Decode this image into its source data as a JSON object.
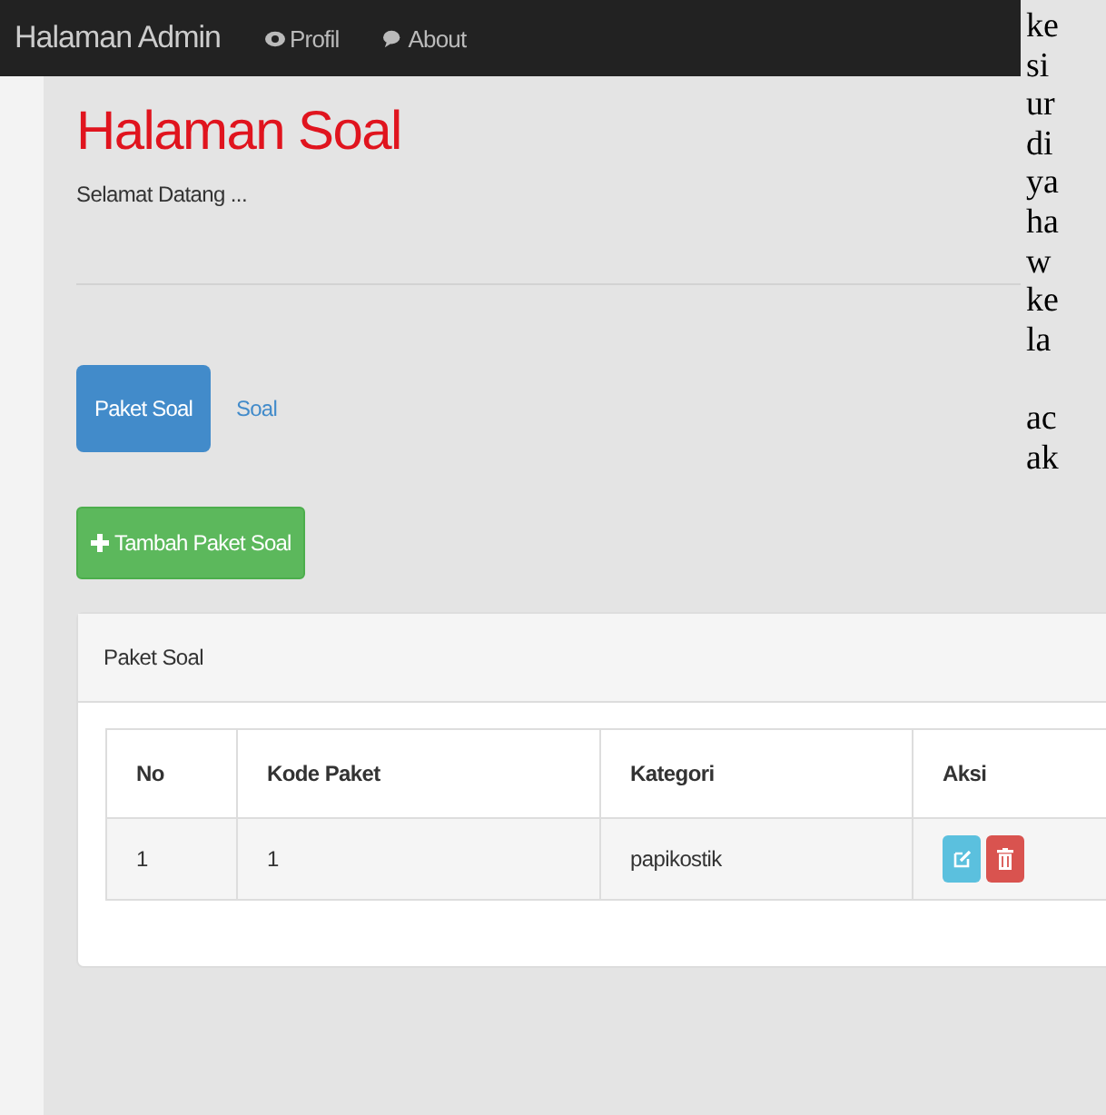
{
  "navbar": {
    "brand": "Halaman Admin",
    "links": [
      {
        "label": "Profil"
      },
      {
        "label": "About"
      }
    ]
  },
  "header": {
    "title": "Halaman Soal",
    "subtitle": "Selamat Datang ..."
  },
  "tabs": [
    {
      "label": "Paket Soal",
      "selected": true
    },
    {
      "label": "Soal",
      "selected": false
    }
  ],
  "add_button": {
    "label": "Tambah Paket Soal"
  },
  "panel": {
    "heading": "Paket Soal",
    "table": {
      "columns": [
        "No",
        "Kode Paket",
        "Kategori",
        "Aksi"
      ],
      "rows": [
        {
          "cells": [
            "1",
            "1",
            "papikostik"
          ]
        }
      ]
    }
  },
  "overlay_text": [
    {
      "lines": [
        "ke",
        "si",
        "ur",
        "di",
        "ya",
        "ha",
        "w",
        "ke",
        "la"
      ]
    },
    {
      "lines": [
        "ac",
        "ak"
      ]
    }
  ]
}
